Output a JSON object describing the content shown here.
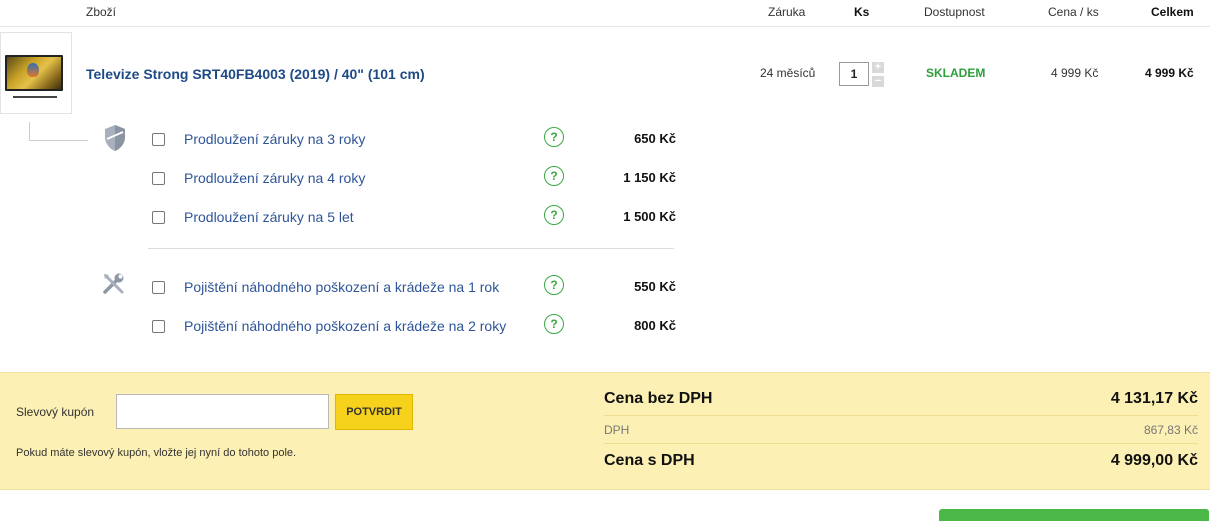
{
  "header": {
    "col_product": "Zboží",
    "col_warranty": "Záruka",
    "col_qty": "Ks",
    "col_availability": "Dostupnost",
    "col_unit_price": "Cena / ks",
    "col_total": "Celkem"
  },
  "product": {
    "name": "Televize Strong SRT40FB4003 (2019) / 40\" (101 cm)",
    "warranty": "24 měsíců",
    "quantity": "1",
    "qty_plus": "+",
    "qty_minus": "−",
    "availability": "SKLADEM",
    "unit_price": "4 999 Kč",
    "total": "4 999 Kč"
  },
  "warranty_options": [
    {
      "label": "Prodloužení záruky na 3 roky",
      "price": "650 Kč",
      "help": "?"
    },
    {
      "label": "Prodloužení záruky na 4 roky",
      "price": "1 150 Kč",
      "help": "?"
    },
    {
      "label": "Prodloužení záruky na 5 let",
      "price": "1 500 Kč",
      "help": "?"
    }
  ],
  "insurance_options": [
    {
      "label": "Pojištění náhodného poškození a krádeže na 1 rok",
      "price": "550 Kč",
      "help": "?"
    },
    {
      "label": "Pojištění náhodného poškození a krádeže na 2 roky",
      "price": "800 Kč",
      "help": "?"
    }
  ],
  "coupon": {
    "label": "Slevový kupón",
    "value": "",
    "button": "POTVRDIT",
    "hint": "Pokud máte slevový kupón, vložte jej nyní do tohoto pole."
  },
  "summary": {
    "net_label": "Cena bez DPH",
    "net_value": "4 131,17 Kč",
    "vat_label": "DPH",
    "vat_value": "867,83 Kč",
    "gross_label": "Cena s DPH",
    "gross_value": "4 999,00 Kč"
  },
  "colors": {
    "link": "#2e5598",
    "stock": "#2f9e3c",
    "band": "#fcf0b4",
    "button": "#f7d21c",
    "checkout": "#4cb848"
  },
  "icons": [
    "shield-icon",
    "tools-icon",
    "help-icon",
    "checkbox"
  ]
}
